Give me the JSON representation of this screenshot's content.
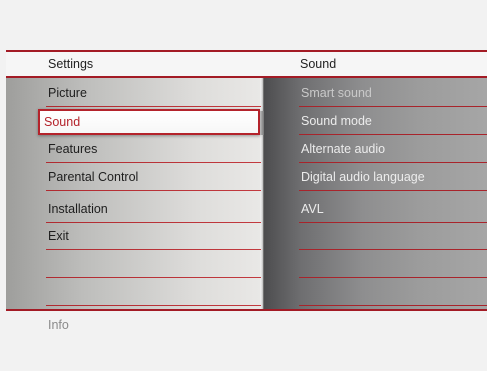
{
  "header": {
    "left_title": "Settings",
    "right_title": "Sound"
  },
  "left_menu": {
    "items": [
      {
        "label": "Picture"
      },
      {
        "label": "Sound",
        "selected": true
      },
      {
        "label": "Features"
      },
      {
        "label": "Parental Control"
      },
      {
        "label": "Installation"
      },
      {
        "label": "Exit"
      },
      {
        "label": ""
      },
      {
        "label": ""
      }
    ]
  },
  "right_menu": {
    "items": [
      {
        "label": "Smart sound"
      },
      {
        "label": "Sound mode"
      },
      {
        "label": "Alternate audio"
      },
      {
        "label": "Digital audio language"
      },
      {
        "label": "AVL"
      },
      {
        "label": ""
      },
      {
        "label": ""
      },
      {
        "label": ""
      }
    ]
  },
  "footer": {
    "info_label": "Info"
  },
  "colors": {
    "accent": "#b4232b",
    "panel_text": "#1e1e1e",
    "submenu_text": "#ececec"
  }
}
